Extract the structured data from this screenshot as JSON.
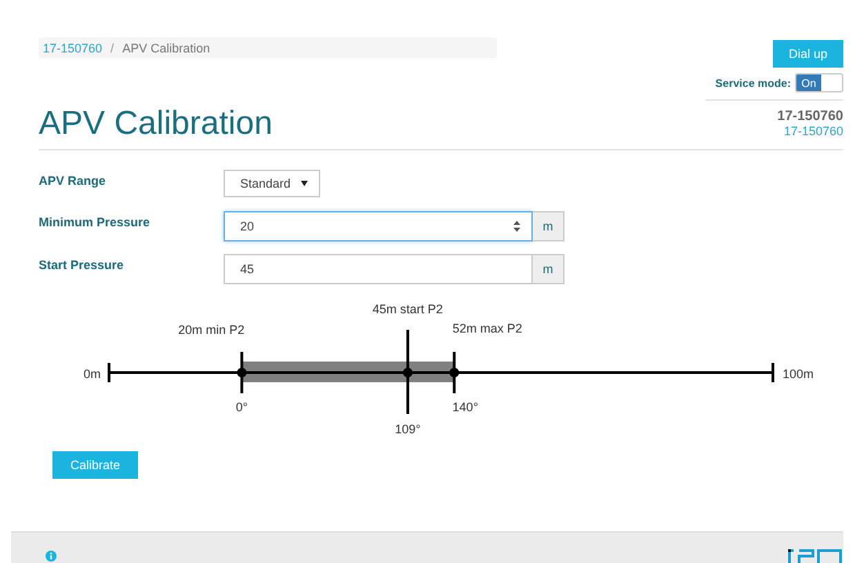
{
  "breadcrumb": [
    {
      "label": "17-150760",
      "kind": "link"
    },
    {
      "label": "APV Calibration",
      "kind": "current"
    }
  ],
  "breadcrumb_separator": "/",
  "dial_button": "Dial up",
  "service_mode": {
    "label": "Service mode:",
    "toggle_label": "On",
    "on": true
  },
  "title": "APV Calibration",
  "device": {
    "name": "17-150760",
    "link": "17-150760"
  },
  "form": [
    {
      "kind": "select",
      "label": "APV Range",
      "value": "Standard"
    },
    {
      "kind": "number",
      "label": "Minimum Pressure",
      "value": "20",
      "unit": "m",
      "focused": true
    },
    {
      "kind": "text",
      "label": "Start Pressure",
      "value": "45",
      "unit": "m",
      "focused": false
    }
  ],
  "diagram": {
    "start_label": "0m",
    "end_label": "100m",
    "markers": [
      {
        "kind": "min",
        "label": "20m min P2",
        "angle": "0°",
        "level": 0.2
      },
      {
        "kind": "start",
        "label": "45m start P2",
        "angle": "109°",
        "level": 0.45
      },
      {
        "kind": "max",
        "label": "52m max P2",
        "angle": "140°",
        "level": 0.52
      }
    ]
  },
  "calibrate_button": "Calibrate"
}
